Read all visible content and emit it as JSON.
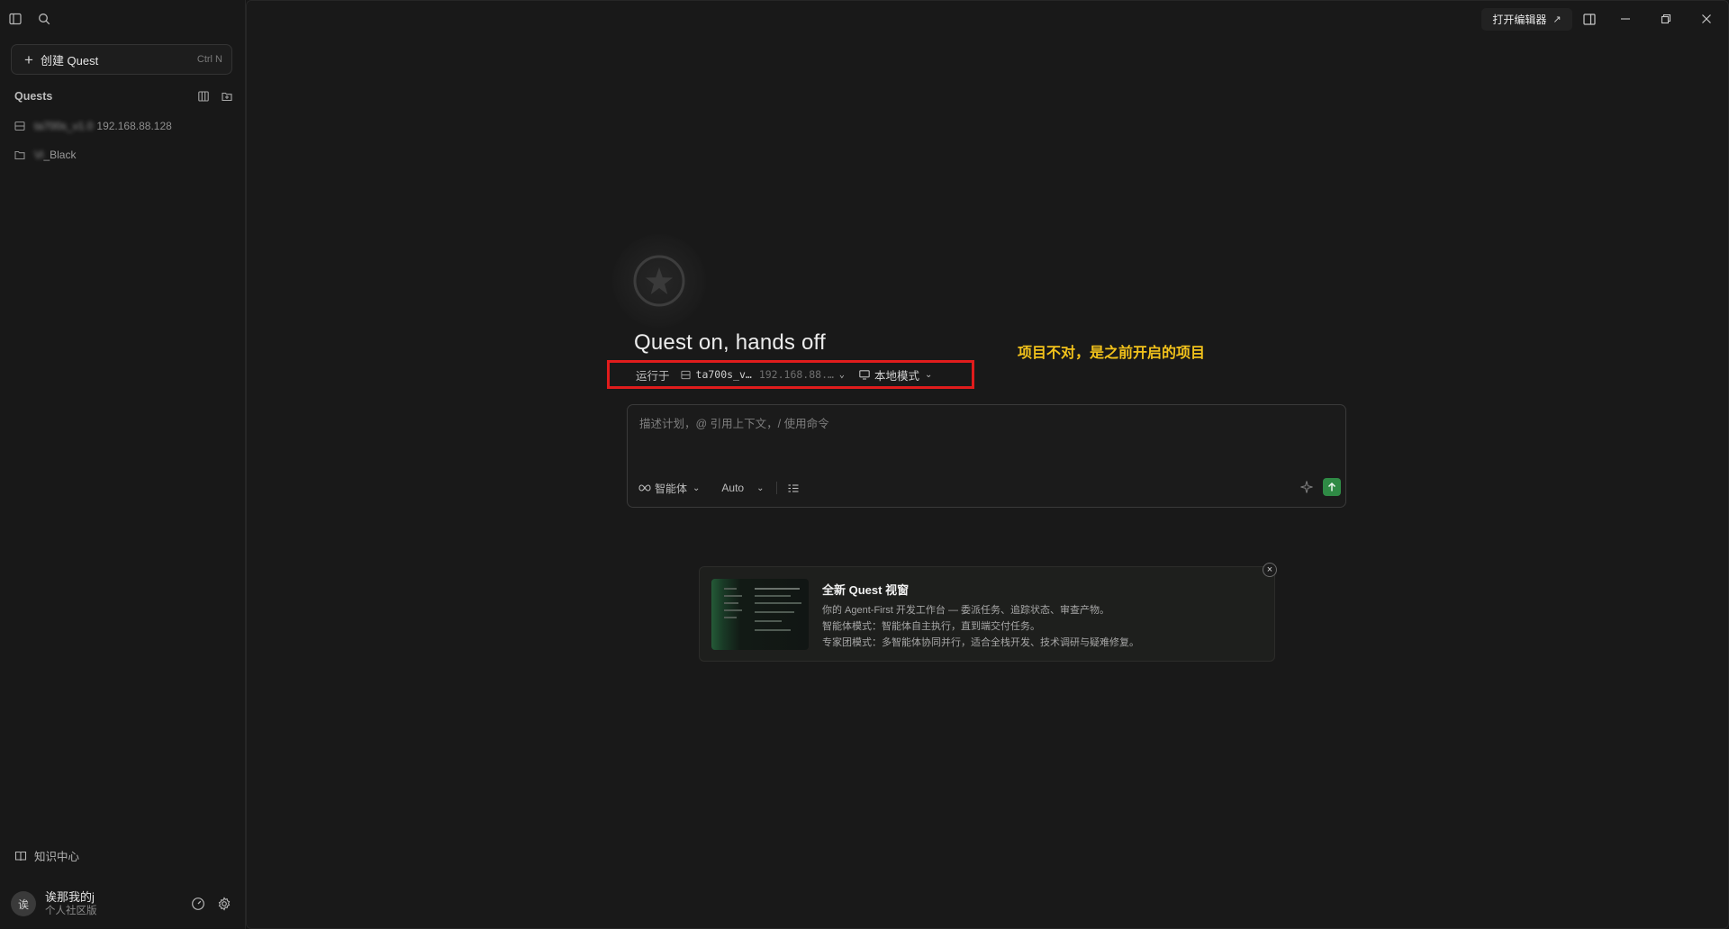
{
  "sidebar": {
    "create_label": "创建 Quest",
    "create_shortcut": "Ctrl N",
    "quests_title": "Quests",
    "quests": [
      {
        "name_blurred": "ta700s_v1.0",
        "ip": "192.168.88.128",
        "icon": "server-icon"
      },
      {
        "name_blurred": "Vi",
        "name_tail": "_Black",
        "icon": "folder-icon"
      }
    ],
    "knowledge_center": "知识中心",
    "user": {
      "avatar": "诶",
      "name": "诶那我的j",
      "plan": "个人社区版"
    }
  },
  "header": {
    "open_editor": "打开编辑器"
  },
  "hero": {
    "headline": "Quest on, hands off",
    "run_label": "运行于",
    "project_name": "ta700s_v…",
    "project_ip": "192.168.88.…",
    "mode_label": "本地模式"
  },
  "annotation": {
    "text": "项目不对，是之前开启的项目",
    "color": "#f2c21b",
    "box_color": "#e01c1c"
  },
  "input": {
    "placeholder": "描述计划，@ 引用上下文，/ 使用命令",
    "agent_label": "智能体",
    "model_label": "Auto"
  },
  "card": {
    "title": "全新 Quest 视窗",
    "line1": "你的 Agent-First 开发工作台 — 委派任务、追踪状态、审查产物。",
    "line2": "智能体模式：智能体自主执行，直到端交付任务。",
    "line3": "专家团模式：多智能体协同并行，适合全栈开发、技术调研与疑难修复。"
  },
  "colors": {
    "accent_green": "#2f8a45",
    "background": "#191919"
  }
}
